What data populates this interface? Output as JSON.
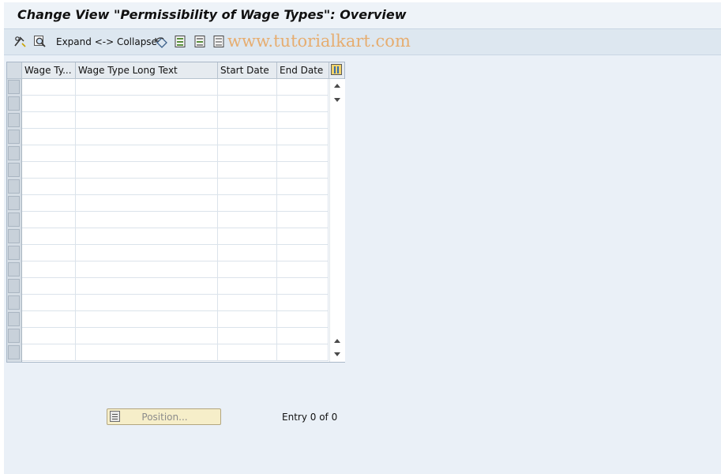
{
  "window": {
    "title": "Change View \"Permissibility of Wage Types\": Overview"
  },
  "toolbar": {
    "items": [
      {
        "icon": "glasses-edit-icon"
      },
      {
        "icon": "find-icon"
      },
      {
        "icon": "expand-collapse",
        "label": "Expand <-> Collapse"
      },
      {
        "icon": "undo-icon"
      },
      {
        "icon": "select-all-icon"
      },
      {
        "icon": "select-block-icon"
      },
      {
        "icon": "deselect-all-icon"
      }
    ],
    "watermark": "www.tutorialkart.com"
  },
  "table": {
    "columns": [
      "Wage Ty...",
      "Wage Type Long Text",
      "Start Date",
      "End Date"
    ],
    "rows": [
      [
        "",
        "",
        "",
        ""
      ],
      [
        "",
        "",
        "",
        ""
      ],
      [
        "",
        "",
        "",
        ""
      ],
      [
        "",
        "",
        "",
        ""
      ],
      [
        "",
        "",
        "",
        ""
      ],
      [
        "",
        "",
        "",
        ""
      ],
      [
        "",
        "",
        "",
        ""
      ],
      [
        "",
        "",
        "",
        ""
      ],
      [
        "",
        "",
        "",
        ""
      ],
      [
        "",
        "",
        "",
        ""
      ],
      [
        "",
        "",
        "",
        ""
      ],
      [
        "",
        "",
        "",
        ""
      ],
      [
        "",
        "",
        "",
        ""
      ],
      [
        "",
        "",
        "",
        ""
      ],
      [
        "",
        "",
        "",
        ""
      ],
      [
        "",
        "",
        "",
        ""
      ],
      [
        "",
        "",
        "",
        ""
      ]
    ]
  },
  "footer": {
    "position_button_label": "Position...",
    "entry_text": "Entry 0 of 0"
  },
  "colors": {
    "background": "#eaf0f7",
    "toolbar": "#dde7f0",
    "watermark": "#e8a35a",
    "position_button": "#f6eec9"
  }
}
